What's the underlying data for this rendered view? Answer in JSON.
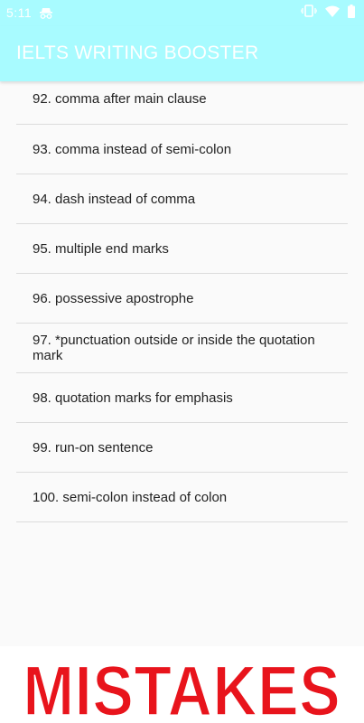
{
  "status_bar": {
    "time": "5:11",
    "icons": [
      "incognito-icon",
      "vibrate-icon",
      "wifi-icon",
      "battery-icon"
    ]
  },
  "app_bar": {
    "title": "IELTS WRITING BOOSTER"
  },
  "list": {
    "items": [
      "92. comma after main clause",
      "93. comma instead of semi-colon",
      "94. dash instead of comma",
      "95. multiple end marks",
      "96. possessive apostrophe",
      "97. *punctuation outside or inside the quotation mark",
      "98. quotation marks for emphasis",
      "99. run-on sentence",
      "100. semi-colon instead of colon"
    ]
  },
  "banner": {
    "text": "MISTAKES"
  },
  "colors": {
    "accent": "#a8fbff",
    "banner_red": "#e8141c"
  }
}
